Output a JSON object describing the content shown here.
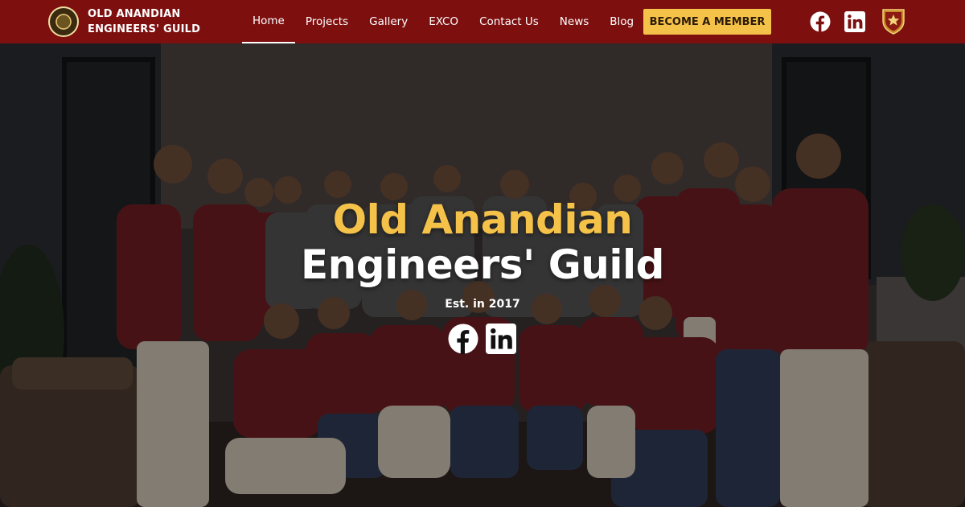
{
  "brand": {
    "name_line1": "OLD ANANDIAN",
    "name_line2": "ENGINEERS' GUILD",
    "logo_icon": "guild-seal-icon"
  },
  "nav": {
    "items": [
      {
        "label": "Home",
        "active": true
      },
      {
        "label": "Projects",
        "active": false
      },
      {
        "label": "Gallery",
        "active": false
      },
      {
        "label": "EXCO",
        "active": false
      },
      {
        "label": "Contact Us",
        "active": false
      },
      {
        "label": "News",
        "active": false
      },
      {
        "label": "Blog",
        "active": false
      }
    ],
    "cta_label": "BECOME A MEMBER",
    "icons": [
      "facebook-icon",
      "linkedin-icon",
      "college-crest-icon"
    ]
  },
  "hero": {
    "title_line1": "Old Anandian",
    "title_line2": "Engineers' Guild",
    "subtitle": "Est. in 2017",
    "icons": [
      "facebook-icon",
      "linkedin-icon"
    ],
    "background": "group photo of guild members in maroon polo shirts"
  },
  "colors": {
    "navbar": "#7d0f0f",
    "accent_gold": "#f5c249",
    "text_white": "#ffffff"
  }
}
